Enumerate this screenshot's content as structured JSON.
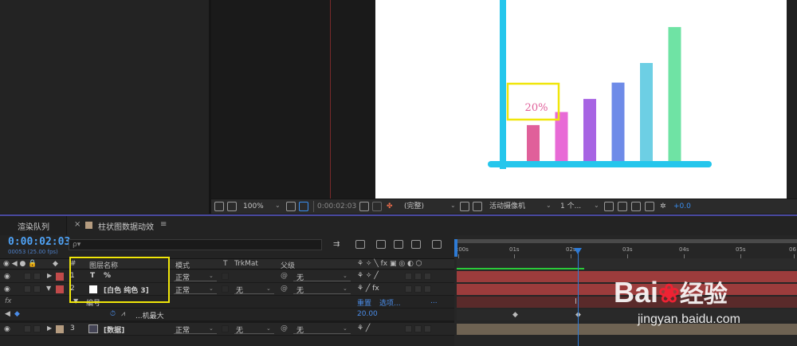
{
  "viewer": {
    "zoom": "100%",
    "timecode": "0:00:02:03",
    "resolution": "(完整)",
    "camera": "活动摄像机",
    "views": "1 个...",
    "exposure": "+0.0"
  },
  "canvas_chart": {
    "label_text": "20%",
    "bar_values": [
      0.22,
      0.3,
      0.38,
      0.48,
      0.6,
      0.82
    ],
    "bar_colors": [
      "#e0609a",
      "#e86ad6",
      "#a764e3",
      "#6e8be8",
      "#6dcfe4",
      "#6fe3a4"
    ],
    "axis_color": "#25c6ec",
    "highlight_color": "#f0e60a",
    "label_color": "#e0609a"
  },
  "tabs": {
    "render_queue": "渲染队列",
    "composition": "柱状图数据动效",
    "close": "×",
    "menu": "≡"
  },
  "timeline": {
    "timecode": "0:00:02:03",
    "fps": "00053 (25.00 fps)",
    "search_placeholder": "ρ▾",
    "columns": {
      "number": "#",
      "layer_name": "图层名称",
      "mode": "模式",
      "t": "T",
      "trkmat": "TrkMat",
      "parent": "父级"
    },
    "layers": [
      {
        "num": "1",
        "type": "T",
        "name": "%",
        "mode": "正常",
        "trkmat": "",
        "parent": "无"
      },
      {
        "num": "2",
        "type": "solid",
        "name": "[白色 纯色 3]",
        "mode": "正常",
        "trkmat": "无",
        "parent": "无"
      },
      {
        "num": "3",
        "type": "comp",
        "name": "[数据]",
        "mode": "正常",
        "trkmat": "无",
        "parent": "无"
      }
    ],
    "effects_row": {
      "name": "编号",
      "reset": "重置",
      "options": "选项...",
      "more": "..."
    },
    "property_row": {
      "name": "...机最大",
      "value": "20.00"
    },
    "ruler_labels": [
      ":00s",
      "01s",
      "02s",
      "03s",
      "04s",
      "05s",
      "06"
    ],
    "colors": {
      "layer1": "#c14a4a",
      "layer2": "#c14a4a",
      "layer3": "#b59c80",
      "playhead": "#2e7bd6",
      "timecode": "#4fa3f7"
    }
  },
  "watermark": {
    "brand": "Bai",
    "brand_tail": "经验",
    "url": "jingyan.baidu.com"
  }
}
